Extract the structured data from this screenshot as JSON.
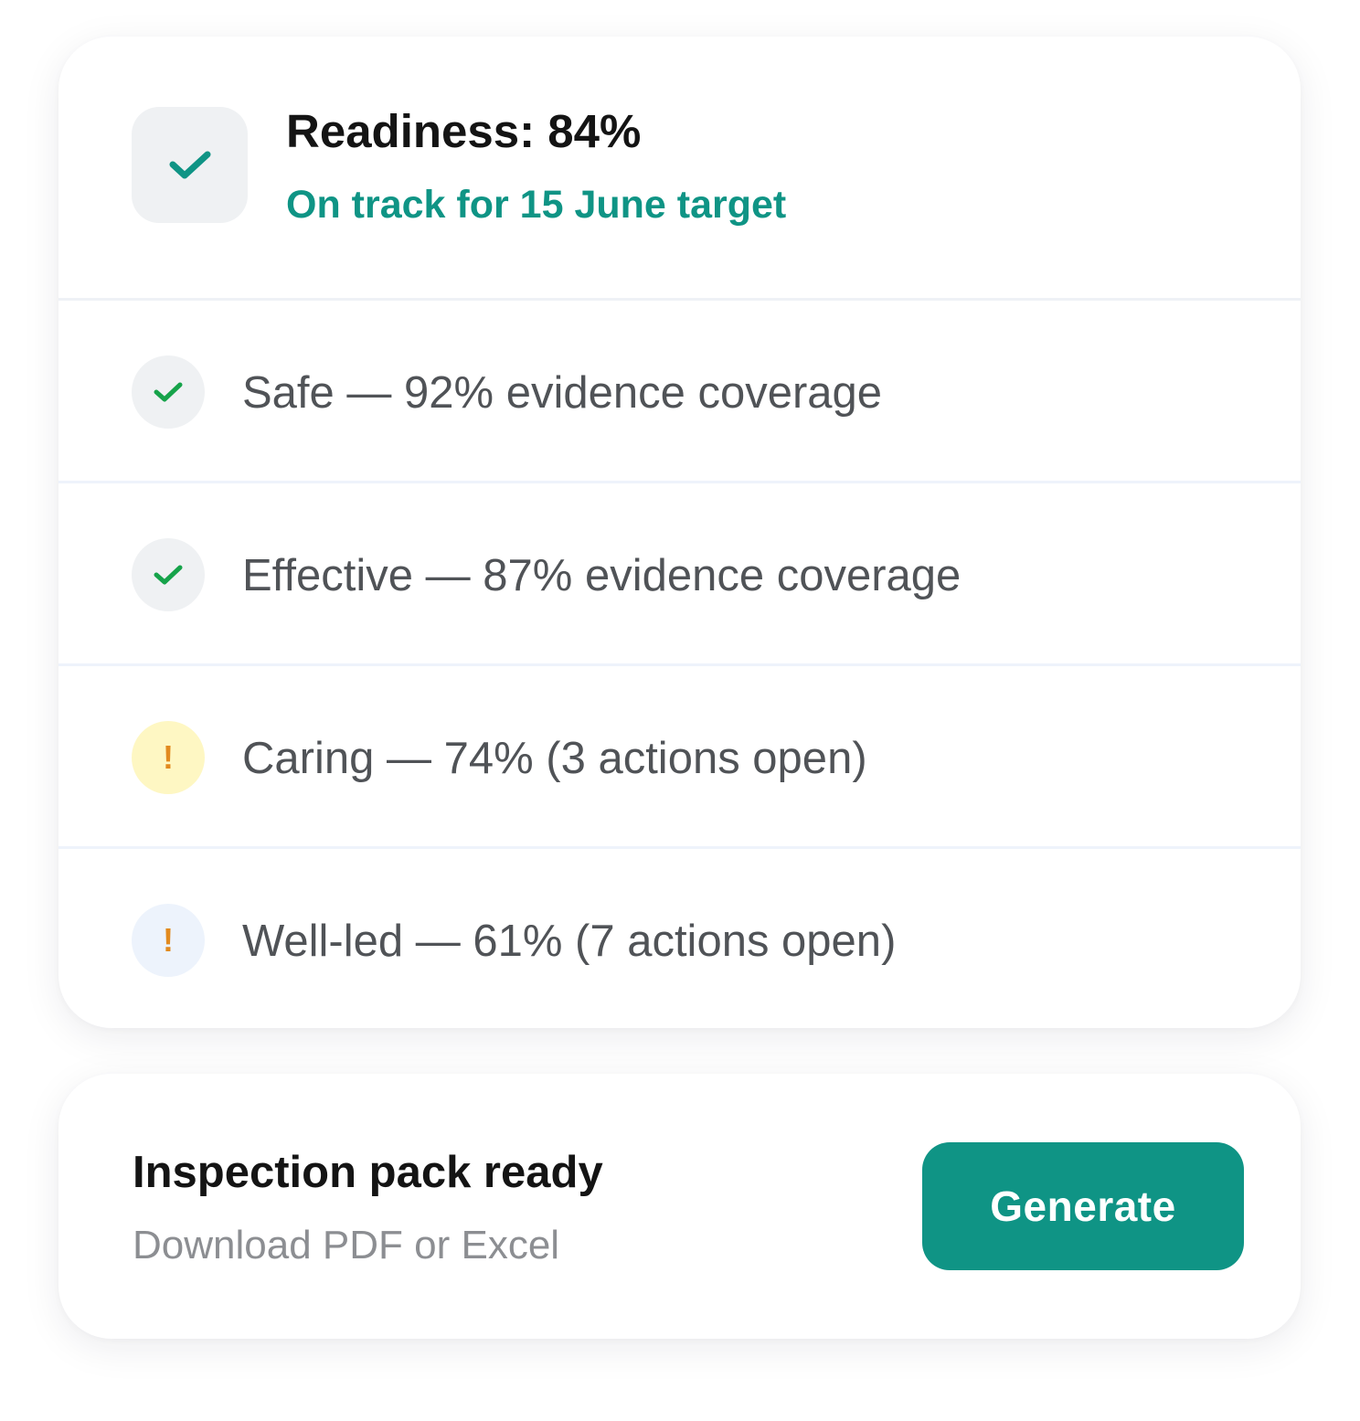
{
  "readiness": {
    "title": "Readiness: 84%",
    "value_percent": 84,
    "subtitle": "On track for 15 June target",
    "icon": "check-icon"
  },
  "domains": [
    {
      "label": "Safe — 92% evidence coverage",
      "coverage_percent": 92,
      "status": "complete",
      "icon": "check-icon"
    },
    {
      "label": "Effective — 87% evidence coverage",
      "coverage_percent": 87,
      "status": "complete",
      "icon": "check-icon"
    },
    {
      "label": "Caring — 74% (3 actions open)",
      "coverage_percent": 74,
      "open_actions": 3,
      "status": "warning",
      "icon": "exclamation-icon"
    },
    {
      "label": "Well-led — 61% (7 actions open)",
      "coverage_percent": 61,
      "open_actions": 7,
      "status": "attention",
      "icon": "exclamation-icon"
    }
  ],
  "inspection_pack": {
    "title": "Inspection pack ready",
    "subtitle": "Download PDF or Excel",
    "button_label": "Generate"
  },
  "colors": {
    "accent_teal": "#0f9485",
    "check_green": "#16a34a",
    "warning_orange": "#e28a1f",
    "warning_bg": "#fef7c3",
    "attention_bg": "#edf3fc",
    "neutral_icon_bg": "#eff1f3"
  }
}
